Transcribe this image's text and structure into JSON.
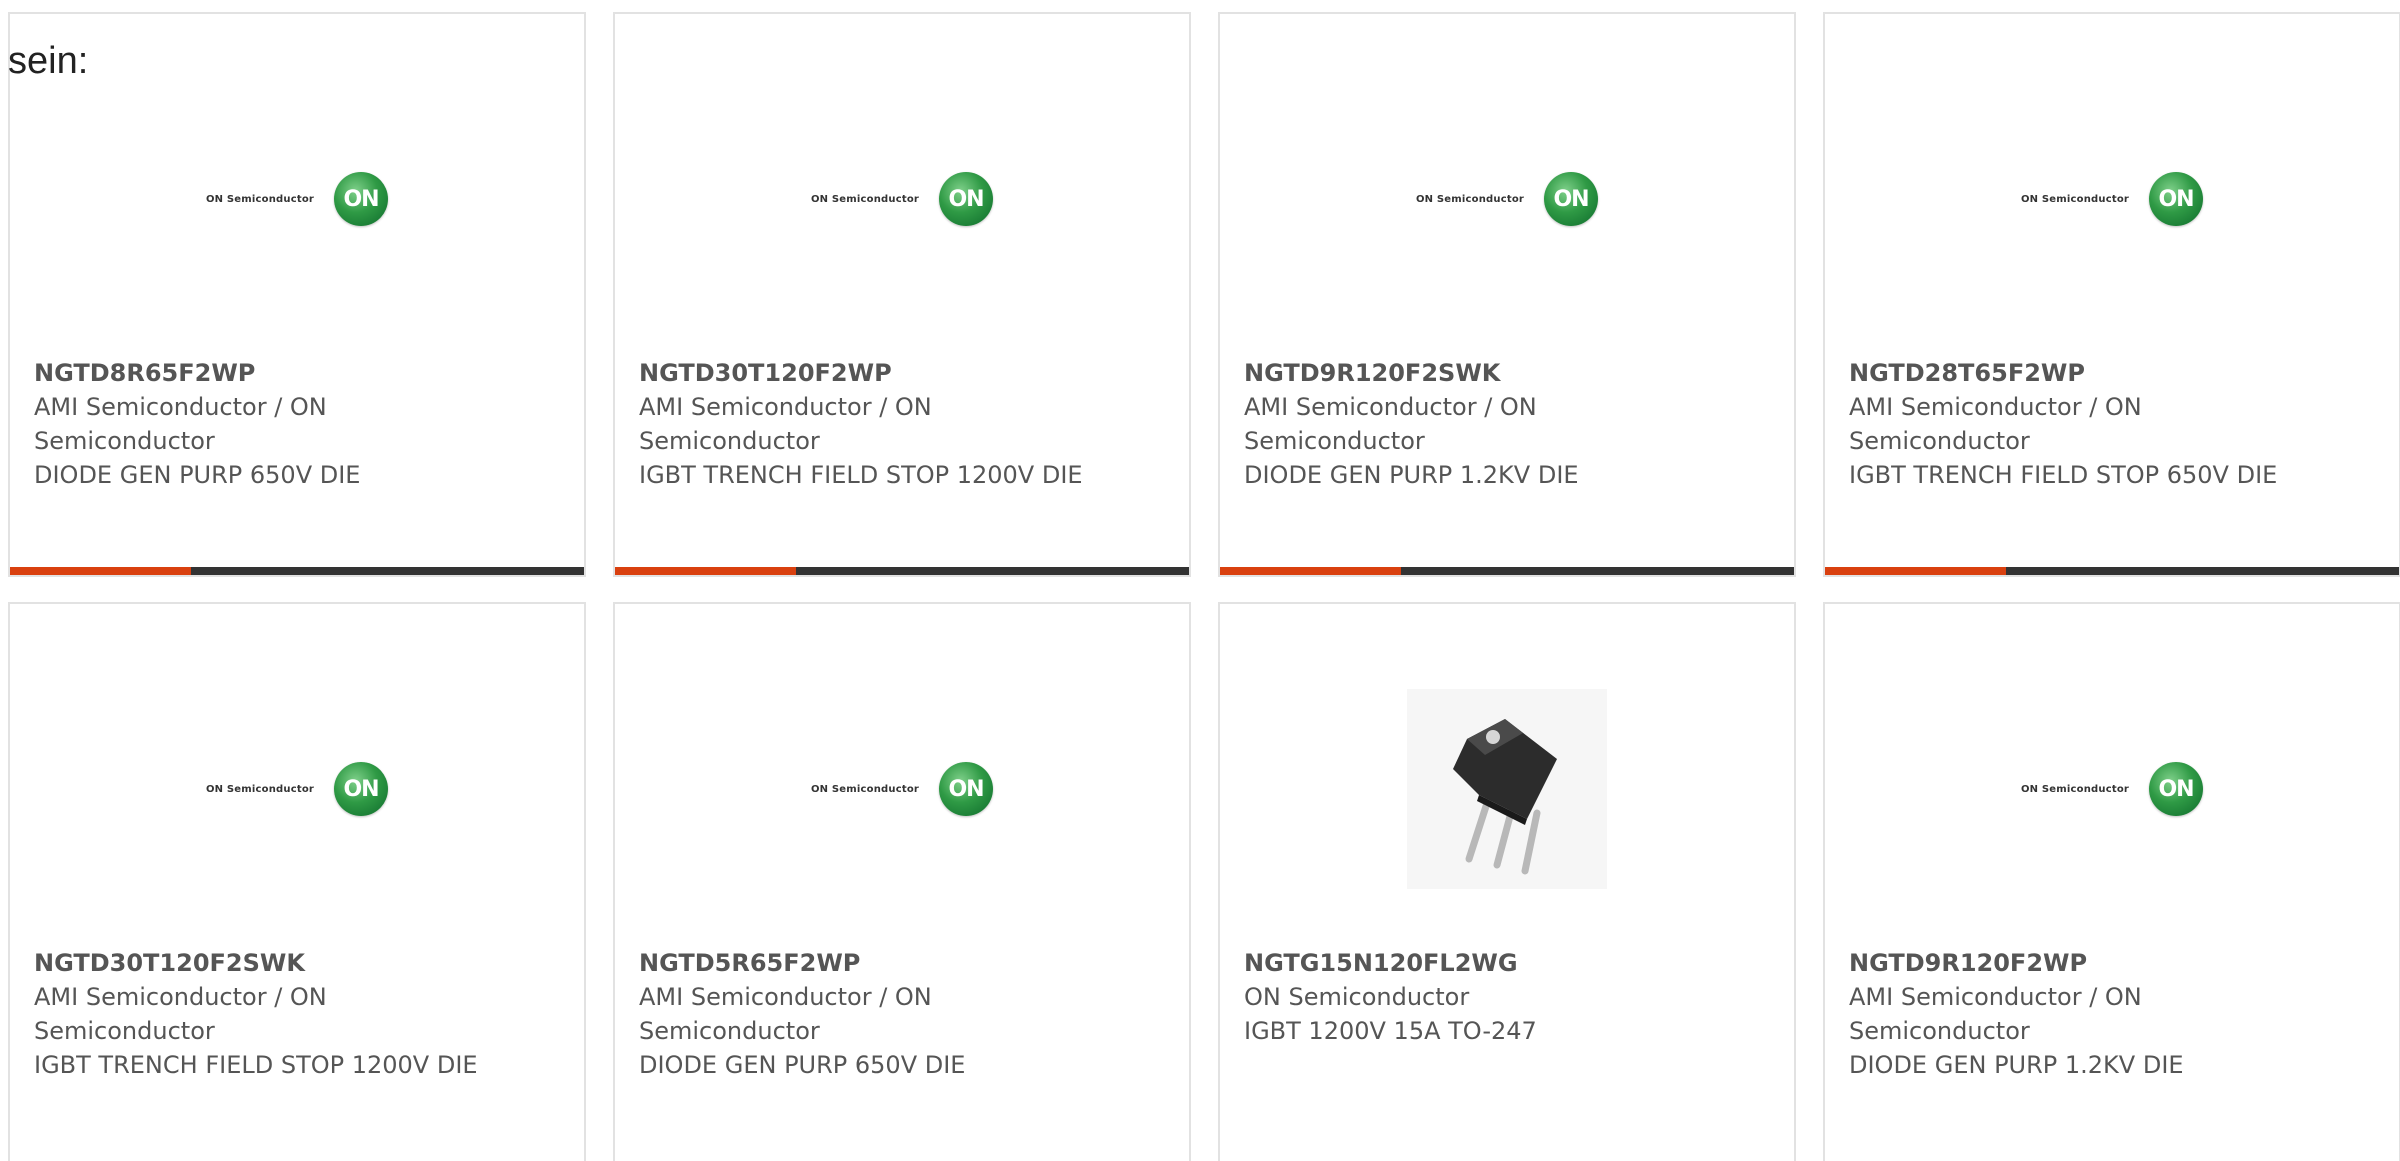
{
  "intro_text": "sein:",
  "logo": {
    "text": "ON Semiconductor",
    "badge": "ON"
  },
  "colors": {
    "accent": "#d9400f",
    "bar_track": "#333333",
    "card_border": "#e2e2e2",
    "text": "#555555"
  },
  "products": [
    {
      "part": "NGTD8R65F2WP",
      "manufacturer": "AMI Semiconductor / ON Semiconductor",
      "description": "DIODE GEN PURP 650V DIE",
      "image": "on-semiconductor-logo",
      "bar_fraction": 0.315
    },
    {
      "part": "NGTD30T120F2WP",
      "manufacturer": "AMI Semiconductor / ON Semiconductor",
      "description": "IGBT TRENCH FIELD STOP 1200V DIE",
      "image": "on-semiconductor-logo",
      "bar_fraction": 0.315
    },
    {
      "part": "NGTD9R120F2SWK",
      "manufacturer": "AMI Semiconductor / ON Semiconductor",
      "description": "DIODE GEN PURP 1.2KV DIE",
      "image": "on-semiconductor-logo",
      "bar_fraction": 0.315
    },
    {
      "part": "NGTD28T65F2WP",
      "manufacturer": "AMI Semiconductor / ON Semiconductor",
      "description": "IGBT TRENCH FIELD STOP 650V DIE",
      "image": "on-semiconductor-logo",
      "bar_fraction": 0.315
    },
    {
      "part": "NGTD30T120F2SWK",
      "manufacturer": "AMI Semiconductor / ON Semiconductor",
      "description": "IGBT TRENCH FIELD STOP 1200V DIE",
      "image": "on-semiconductor-logo"
    },
    {
      "part": "NGTD5R65F2WP",
      "manufacturer": "AMI Semiconductor / ON Semiconductor",
      "description": "DIODE GEN PURP 650V DIE",
      "image": "on-semiconductor-logo"
    },
    {
      "part": "NGTG15N120FL2WG",
      "manufacturer": "ON Semiconductor",
      "description": "IGBT 1200V 15A TO-247",
      "image": "to-247-transistor-photo"
    },
    {
      "part": "NGTD9R120F2WP",
      "manufacturer": "AMI Semiconductor / ON Semiconductor",
      "description": "DIODE GEN PURP 1.2KV DIE",
      "image": "on-semiconductor-logo"
    }
  ]
}
